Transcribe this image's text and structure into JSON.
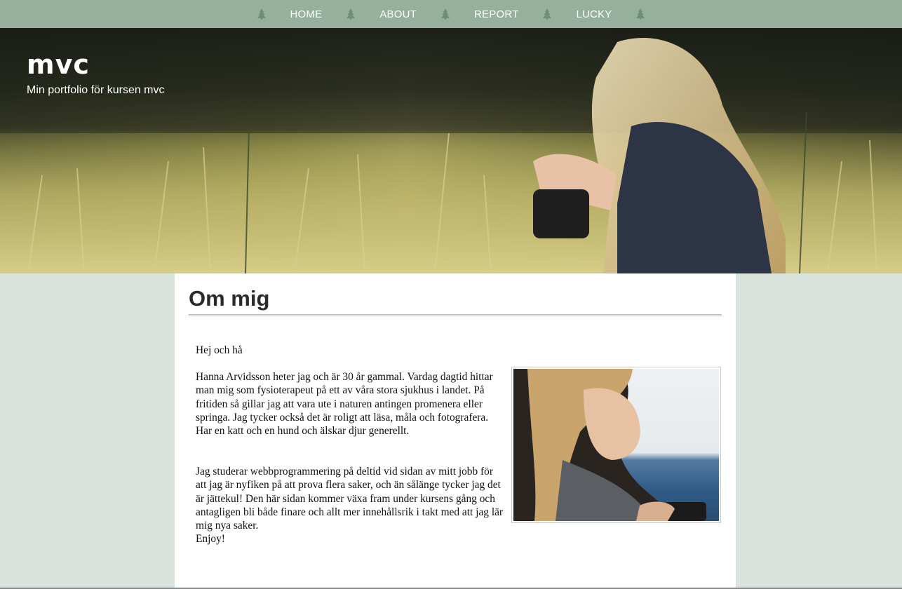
{
  "nav": {
    "items": [
      {
        "label": "HOME"
      },
      {
        "label": "ABOUT"
      },
      {
        "label": "REPORT"
      },
      {
        "label": "LUCKY"
      }
    ],
    "separator_icon": "tree-icon",
    "background": "#95b09d"
  },
  "header": {
    "title": "mvc",
    "subtitle": "Min portfolio för kursen mvc"
  },
  "main": {
    "heading": "Om mig",
    "greeting": "Hej och hå",
    "paragraph1": "Hanna Arvidsson heter jag och är 30 år gammal. Vardag dagtid hittar man mig som fysioterapeut på ett av våra stora sjukhus i landet. På fritiden så gillar jag att vara ute i naturen antingen promenera eller springa. Jag tycker också det är roligt att läsa, måla och fotografera. Har en katt och en hund och älskar djur generellt.",
    "paragraph2": "Jag studerar webbprogrammering på deltid vid sidan av mitt jobb för att jag är nyfiken på att prova flera saker, och än sålänge tycker jag det är jättekul! Den här sidan kommer växa fram under kursens gång och antagligen bli både finare och allt mer innehållsrik i takt med att jag lär mig nya saker.",
    "closing": "Enjoy!"
  },
  "colors": {
    "page_background": "#d9e3dc",
    "content_background": "#ffffff"
  }
}
